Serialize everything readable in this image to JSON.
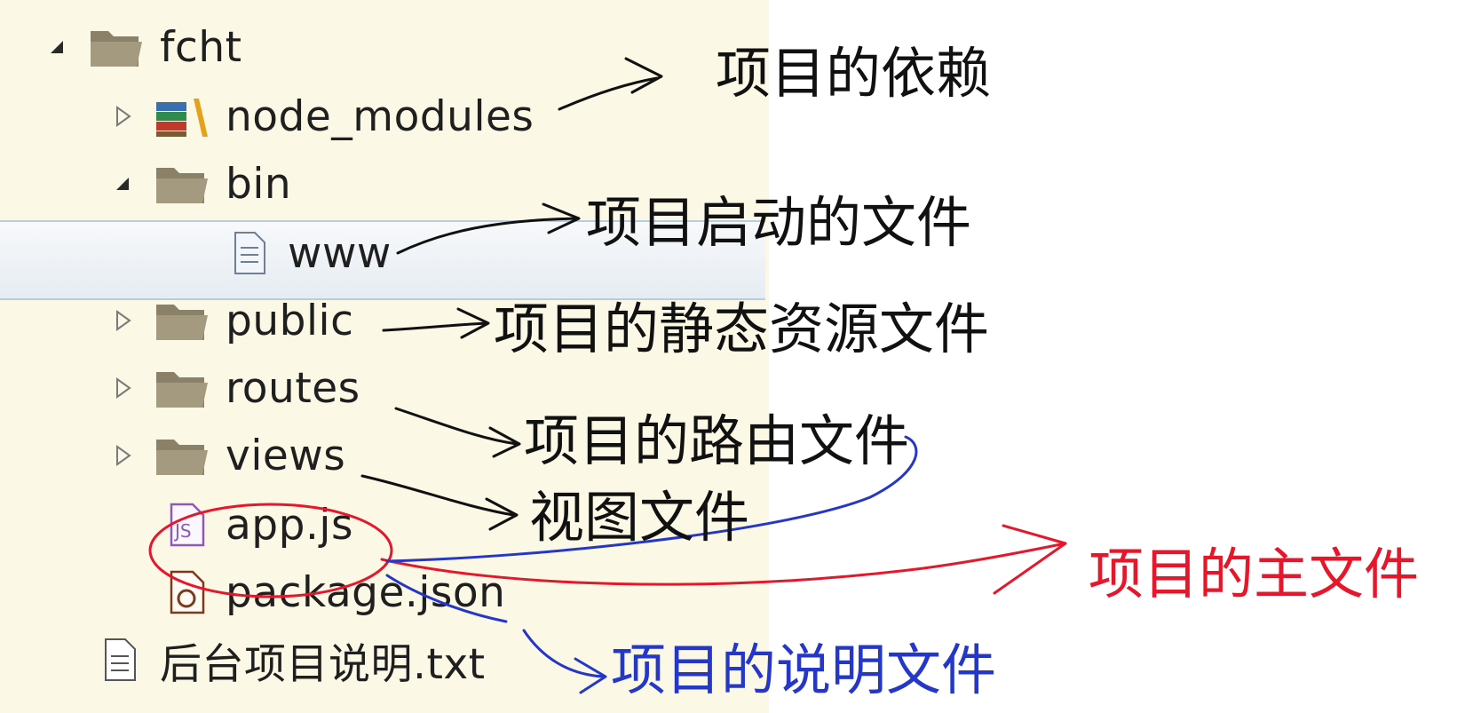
{
  "tree": {
    "root": {
      "label": "fcht",
      "expanded": true
    },
    "items": [
      {
        "label": "node_modules",
        "icon": "library-icon",
        "expanded": false
      },
      {
        "label": "bin",
        "icon": "folder-icon",
        "expanded": true
      },
      {
        "label": "www",
        "icon": "file-icon",
        "selected": true
      },
      {
        "label": "public",
        "icon": "folder-icon",
        "expanded": false
      },
      {
        "label": "routes",
        "icon": "folder-icon",
        "expanded": false
      },
      {
        "label": "views",
        "icon": "folder-icon",
        "expanded": false
      },
      {
        "label": "app.js",
        "icon": "js-file-icon"
      },
      {
        "label": "package.json",
        "icon": "json-file-icon"
      },
      {
        "label": "后台项目说明.txt",
        "icon": "text-file-icon"
      }
    ]
  },
  "annotations": {
    "dependencies": "项目的依赖",
    "startup": "项目启动的文件",
    "static": "项目的静态资源文件",
    "routes": "项目的路由文件",
    "views": "视图文件",
    "main": "项目的主文件",
    "manifest": "项目的说明文件"
  },
  "colors": {
    "panel": "#fcf8e6",
    "annotation_black": "#111111",
    "annotation_red": "#e8162a",
    "annotation_blue": "#2437c9",
    "folder": "#8b8168"
  }
}
